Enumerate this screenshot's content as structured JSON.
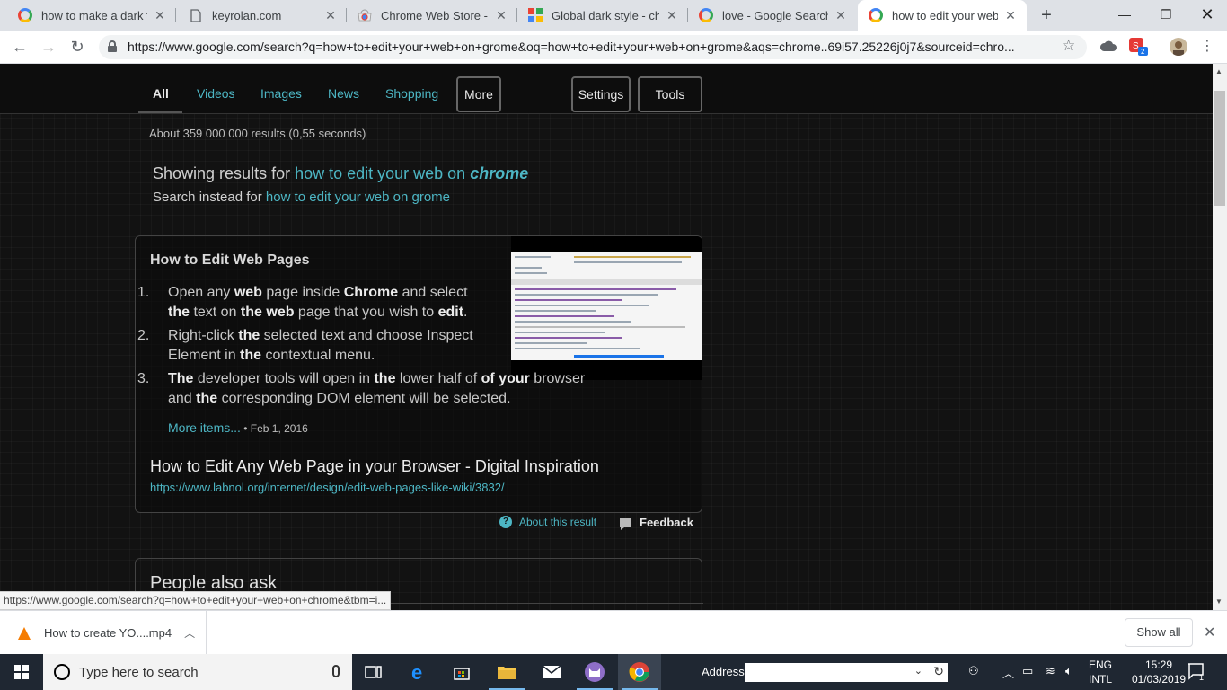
{
  "browser": {
    "tabs": [
      {
        "title": "how to make a dark the",
        "icon": "google-icon",
        "active": false
      },
      {
        "title": "keyrolan.com",
        "icon": "page-icon",
        "active": false
      },
      {
        "title": "Chrome Web Store - th",
        "icon": "webstore-icon",
        "active": false
      },
      {
        "title": "Global dark style - chan",
        "icon": "grid-app-icon",
        "active": false
      },
      {
        "title": "love - Google Search",
        "icon": "google-icon",
        "active": false
      },
      {
        "title": "how to edit your web o",
        "icon": "google-icon",
        "active": true
      }
    ],
    "url": "https://www.google.com/search?q=how+to+edit+your+web+on+grome&oq=how+to+edit+your+web+on+grome&aqs=chrome..69i57.25226j0j7&sourceid=chro...",
    "extension_badge": "2"
  },
  "search_nav": {
    "tabs": [
      "All",
      "Videos",
      "Images",
      "News",
      "Shopping"
    ],
    "more": "More",
    "settings": "Settings",
    "tools": "Tools"
  },
  "results": {
    "stats": "About 359 000 000 results (0,55 seconds)",
    "showing_prefix": "Showing results for ",
    "showing_plain": "how to edit your web on ",
    "showing_bold": "chrome",
    "instead_prefix": "Search instead for ",
    "instead_link": "how to edit your web on grome"
  },
  "snippet": {
    "title": "How to Edit Web Pages",
    "steps": [
      {
        "num": "1.",
        "parts": [
          [
            "Open any ",
            false
          ],
          [
            "web",
            true
          ],
          [
            " page inside ",
            false
          ],
          [
            "Chrome",
            true
          ],
          [
            " and select ",
            false
          ],
          [
            "the",
            true
          ],
          [
            " text on ",
            false
          ],
          [
            "the web",
            true
          ],
          [
            " page that you wish to ",
            false
          ],
          [
            "edit",
            true
          ],
          [
            ".",
            false
          ]
        ]
      },
      {
        "num": "2.",
        "parts": [
          [
            "Right-click ",
            false
          ],
          [
            "the",
            true
          ],
          [
            " selected text and choose Inspect Element in ",
            false
          ],
          [
            "the",
            true
          ],
          [
            " contextual menu.",
            false
          ]
        ]
      },
      {
        "num": "3.",
        "parts": [
          [
            "The",
            true
          ],
          [
            " developer tools will open in ",
            false
          ],
          [
            "the",
            true
          ],
          [
            " lower half of ",
            false
          ],
          [
            "of your",
            true
          ],
          [
            " browser and ",
            false
          ],
          [
            "the",
            true
          ],
          [
            " corresponding DOM element will be selected.",
            false
          ]
        ]
      }
    ],
    "more_items": "More items...",
    "date": " • Feb 1, 2016",
    "link_title": "How to Edit Any Web Page in your Browser - Digital Inspiration",
    "link_url": "https://www.labnol.org/internet/design/edit-web-pages-like-wiki/3832/"
  },
  "about_result": "About this result",
  "feedback": "Feedback",
  "people_also_ask": "People also ask",
  "status_url": "https://www.google.com/search?q=how+to+edit+your+web+on+chrome&tbm=i...",
  "downloads": {
    "file": "How to create YO....mp4",
    "show_all": "Show all"
  },
  "taskbar": {
    "search_placeholder": "Type here to search",
    "address_label": "Address",
    "lang_top": "ENG",
    "lang_bottom": "INTL",
    "time": "15:29",
    "date": "01/03/2019",
    "notification_count": "1"
  },
  "colors": {
    "link": "#4db6c4",
    "page_bg": "#121212",
    "taskbar": "#1f2732"
  }
}
